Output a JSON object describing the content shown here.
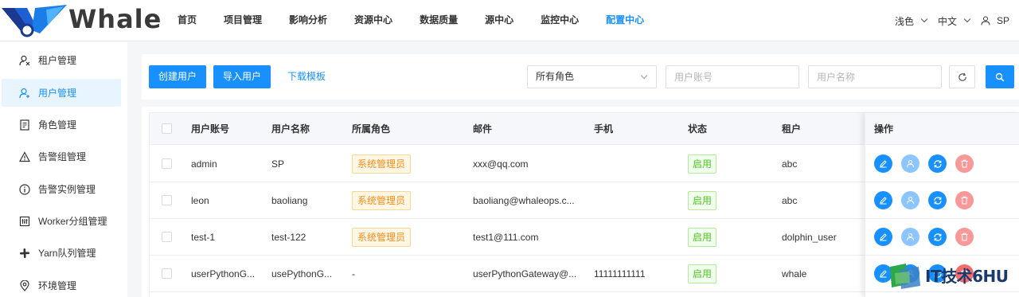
{
  "app": {
    "logo_text": "Whale"
  },
  "nav": [
    {
      "label": "首页",
      "active": false
    },
    {
      "label": "项目管理",
      "active": false
    },
    {
      "label": "影响分析",
      "active": false
    },
    {
      "label": "资源中心",
      "active": false
    },
    {
      "label": "数据质量",
      "active": false
    },
    {
      "label": "源中心",
      "active": false
    },
    {
      "label": "监控中心",
      "active": false
    },
    {
      "label": "配置中心",
      "active": true
    }
  ],
  "header_right": {
    "theme": "浅色",
    "language": "中文",
    "user": "SP"
  },
  "sidebar": {
    "items": [
      {
        "label": "租户管理",
        "icon": "tenant-icon",
        "active": false
      },
      {
        "label": "用户管理",
        "icon": "user-add-icon",
        "active": true
      },
      {
        "label": "角色管理",
        "icon": "role-doc-icon",
        "active": false
      },
      {
        "label": "告警组管理",
        "icon": "warning-icon",
        "active": false
      },
      {
        "label": "告警实例管理",
        "icon": "info-icon",
        "active": false
      },
      {
        "label": "Worker分组管理",
        "icon": "worker-group-icon",
        "active": false
      },
      {
        "label": "Yarn队列管理",
        "icon": "slack-icon",
        "active": false
      },
      {
        "label": "环境管理",
        "icon": "location-icon",
        "active": false
      }
    ]
  },
  "toolbar": {
    "create_label": "创建用户",
    "import_label": "导入用户",
    "download_label": "下载模板",
    "role_select_value": "所有角色",
    "account_placeholder": "用户账号",
    "name_placeholder": "用户名称"
  },
  "table": {
    "headers": {
      "account": "用户账号",
      "name": "用户名称",
      "role": "所属角色",
      "email": "邮件",
      "phone": "手机",
      "status": "状态",
      "tenant": "租户",
      "ops": "操作"
    },
    "rows": [
      {
        "account": "admin",
        "name": "SP",
        "role": "系统管理员",
        "email": "xxx@qq.com",
        "phone": "",
        "status": "启用",
        "tenant": "abc"
      },
      {
        "account": "leon",
        "name": "baoliang",
        "role": "系统管理员",
        "email": "baoliang@whaleops.c...",
        "phone": "",
        "status": "启用",
        "tenant": "abc"
      },
      {
        "account": "test-1",
        "name": "test-122",
        "role": "系统管理员",
        "email": "test1@111.com",
        "phone": "",
        "status": "启用",
        "tenant": "dolphin_user"
      },
      {
        "account": "userPythonG...",
        "name": "usePythonG...",
        "role": "-",
        "email": "userPythonGateway@...",
        "phone": "11111111111",
        "status": "启用",
        "tenant": "whale"
      }
    ]
  },
  "watermark": {
    "text": "IT技术6HU"
  },
  "colors": {
    "primary": "#1890ff",
    "role_tag": "#fa8c16",
    "status_tag": "#52c41a",
    "danger": "#f89898"
  }
}
